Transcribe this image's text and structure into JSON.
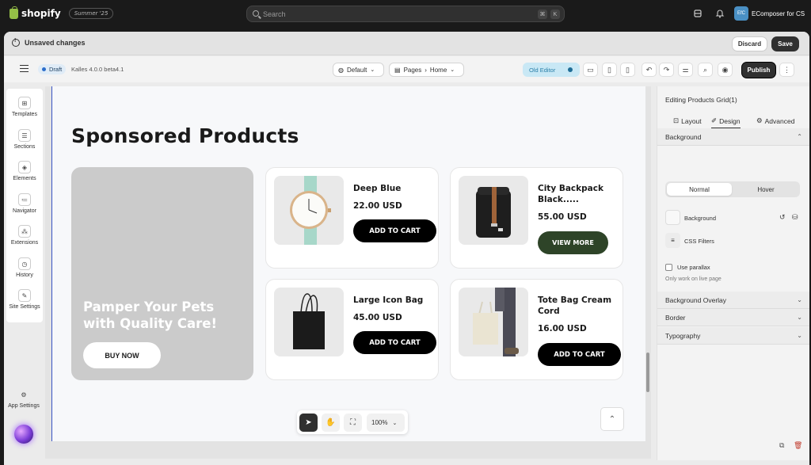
{
  "topbar": {
    "brand": "shopify",
    "edition": "Summer '25",
    "search_placeholder": "Search",
    "shortcut_keys": [
      "⌘",
      "K"
    ],
    "store_initials": "EfC",
    "store_name": "EComposer for CS"
  },
  "savebar": {
    "message": "Unsaved changes",
    "discard_label": "Discard",
    "save_label": "Save"
  },
  "editorbar": {
    "status": "Draft",
    "theme": "Kalles 4.0.0 beta4.1",
    "device_template": "Default",
    "breadcrumb_root": "Pages",
    "breadcrumb_page": "Home",
    "old_editor_label": "Old Editor",
    "publish_label": "Publish"
  },
  "leftbar": {
    "items": [
      {
        "label": "Templates",
        "icon": "templates-icon"
      },
      {
        "label": "Sections",
        "icon": "sections-icon"
      },
      {
        "label": "Elements",
        "icon": "elements-icon"
      },
      {
        "label": "Navigator",
        "icon": "navigator-icon"
      },
      {
        "label": "Extensions",
        "icon": "extensions-icon"
      },
      {
        "label": "History",
        "icon": "history-icon"
      },
      {
        "label": "Site Settings",
        "icon": "site-settings-icon"
      }
    ],
    "app_settings": "App Settings"
  },
  "canvas": {
    "heading": "Sponsored Products",
    "banner_text": "Pamper Your Pets with Quality Care!",
    "banner_button": "BUY NOW",
    "products": [
      {
        "name": "Deep Blue",
        "price": "22.00 USD",
        "button": "ADD TO CART"
      },
      {
        "name": "City Backpack Black.....",
        "price": "55.00 USD",
        "button": "VIEW MORE"
      },
      {
        "name": "Large Icon Bag",
        "price": "45.00 USD",
        "button": "ADD TO CART"
      },
      {
        "name": "Tote Bag Cream Cord",
        "price": "16.00 USD",
        "button": "ADD TO CART"
      }
    ],
    "zoom": "100%"
  },
  "rightpanel": {
    "title": "Editing Products Grid(1)",
    "tabs": [
      "Layout",
      "Design",
      "Advanced"
    ],
    "background_section": "Background",
    "states": [
      "Normal",
      "Hover"
    ],
    "background_label": "Background",
    "css_filters_label": "CSS Filters",
    "parallax_label": "Use parallax",
    "parallax_hint": "Only work on live page",
    "sections": [
      "Background Overlay",
      "Border",
      "Typography"
    ]
  },
  "colors": {
    "accent_dark": "#303030",
    "view_more_green": "#2e4428",
    "canvas_border": "#3a55c4",
    "banner_gray": "#cbcbcb"
  }
}
